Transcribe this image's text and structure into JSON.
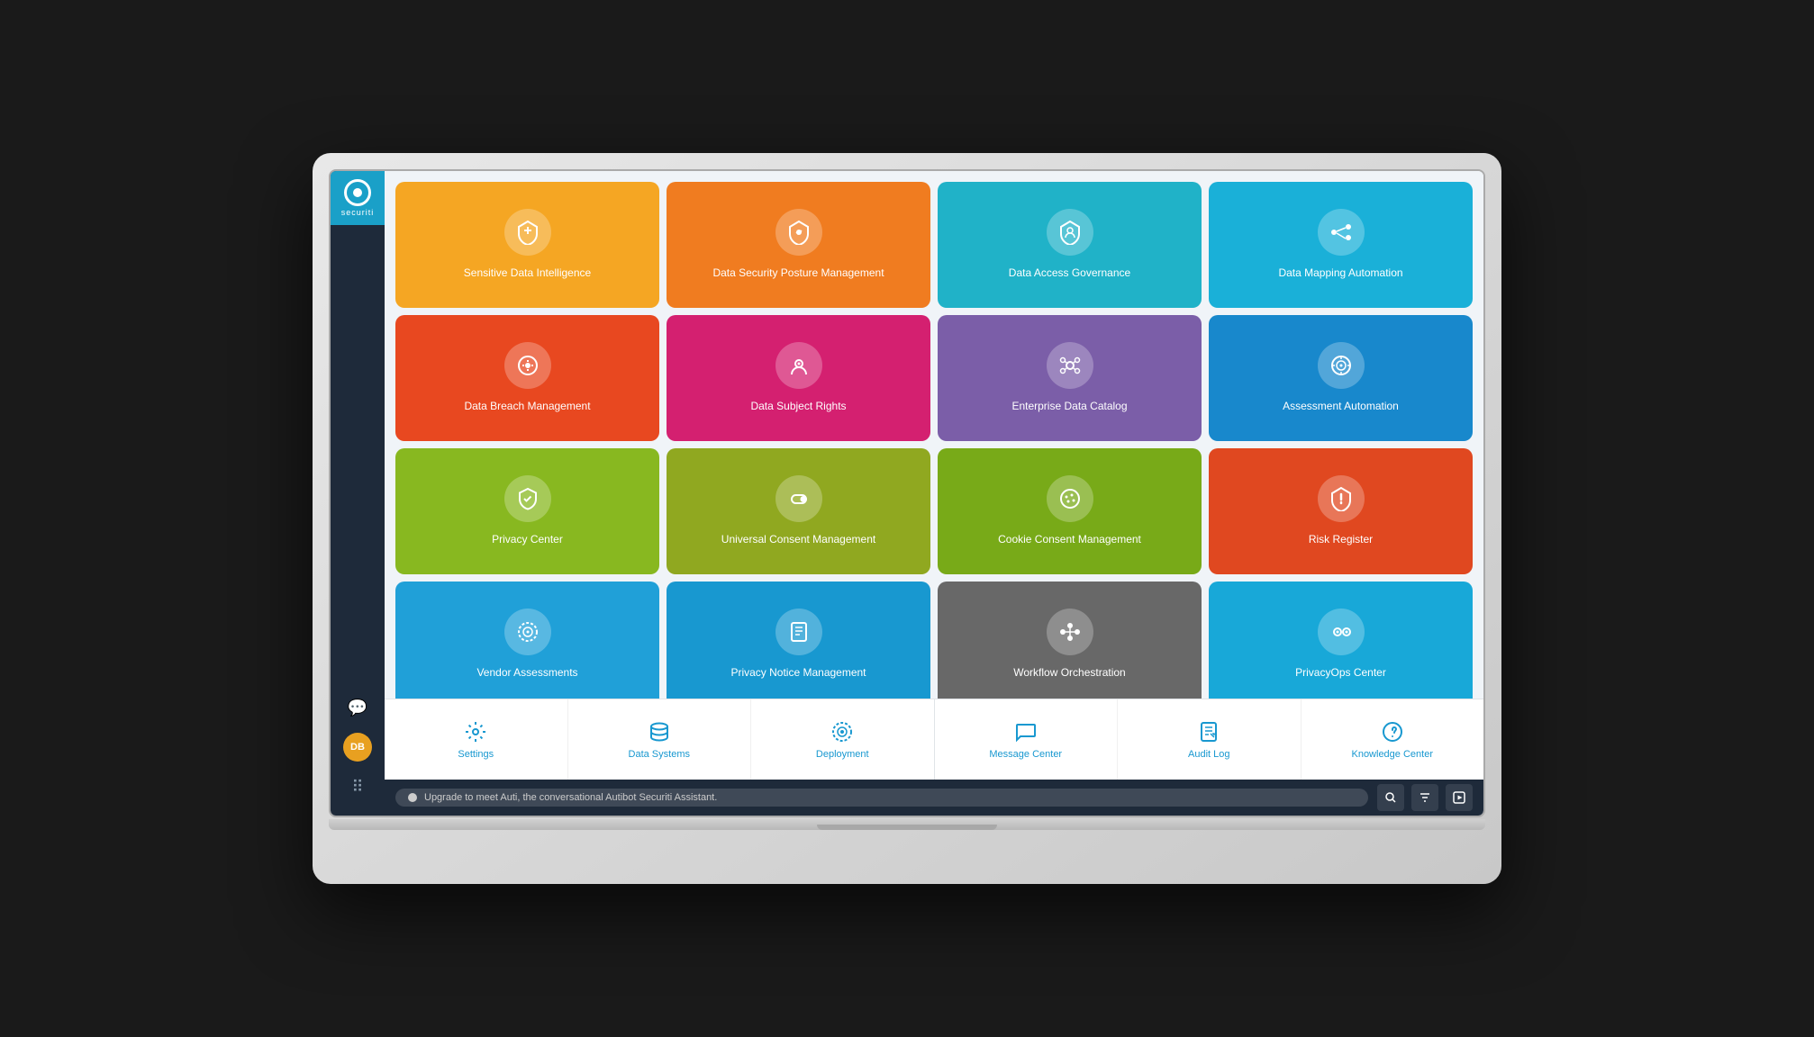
{
  "sidebar": {
    "logo_text": "securiti",
    "bottom_icons": [
      {
        "name": "chat-icon",
        "symbol": "💬"
      },
      {
        "name": "avatar-icon",
        "initials": "DB"
      },
      {
        "name": "apps-icon",
        "symbol": "⠿"
      }
    ]
  },
  "grid": {
    "rows": [
      [
        {
          "id": "sensitive-data",
          "label": "Sensitive Data Intelligence",
          "color": "tile-orange",
          "icon": "⬡"
        },
        {
          "id": "data-security-posture",
          "label": "Data Security Posture Management",
          "color": "tile-orange2",
          "icon": "🛡"
        },
        {
          "id": "data-access",
          "label": "Data Access Governance",
          "color": "tile-teal",
          "icon": "🔒"
        },
        {
          "id": "data-mapping",
          "label": "Data Mapping Automation",
          "color": "tile-cyan",
          "icon": "⇄"
        }
      ],
      [
        {
          "id": "data-breach",
          "label": "Data Breach Management",
          "color": "tile-red-orange",
          "icon": "📡"
        },
        {
          "id": "data-subject",
          "label": "Data Subject Rights",
          "color": "tile-magenta",
          "icon": "⊙"
        },
        {
          "id": "enterprise-catalog",
          "label": "Enterprise Data Catalog",
          "color": "tile-purple",
          "icon": "⦾"
        },
        {
          "id": "assessment",
          "label": "Assessment Automation",
          "color": "tile-blue",
          "icon": "◎"
        }
      ],
      [
        {
          "id": "privacy-center",
          "label": "Privacy Center",
          "color": "tile-lime",
          "icon": "⬡"
        },
        {
          "id": "universal-consent",
          "label": "Universal Consent Management",
          "color": "tile-olive",
          "icon": "⊟"
        },
        {
          "id": "cookie-consent",
          "label": "Cookie Consent Management",
          "color": "tile-green",
          "icon": "⊕"
        },
        {
          "id": "risk-register",
          "label": "Risk Register",
          "color": "tile-red",
          "icon": "⚠"
        }
      ],
      [
        {
          "id": "vendor-assessments",
          "label": "Vendor Assessments",
          "color": "tile-sky",
          "icon": "⚙"
        },
        {
          "id": "privacy-notice",
          "label": "Privacy Notice Management",
          "color": "tile-sky2",
          "icon": "≡"
        },
        {
          "id": "workflow",
          "label": "Workflow Orchestration",
          "color": "tile-gray",
          "icon": "⊕"
        },
        {
          "id": "privacyops",
          "label": "PrivacyOps Center",
          "color": "tile-cyan2",
          "icon": "⊙"
        }
      ]
    ]
  },
  "bottom_nav": {
    "left_items": [
      {
        "id": "settings",
        "label": "Settings",
        "icon": "⚙"
      },
      {
        "id": "data-systems",
        "label": "Data Systems",
        "icon": "🗄"
      },
      {
        "id": "deployment",
        "label": "Deployment",
        "icon": "⚙"
      }
    ],
    "right_items": [
      {
        "id": "message-center",
        "label": "Message Center",
        "icon": "💬"
      },
      {
        "id": "audit-log",
        "label": "Audit Log",
        "icon": "≡"
      },
      {
        "id": "knowledge-center",
        "label": "Knowledge Center",
        "icon": "?"
      }
    ]
  },
  "status_bar": {
    "message": "Upgrade to meet Auti, the conversational Autibot Securiti Assistant.",
    "actions": [
      "🔍",
      "⚙",
      "▶"
    ]
  }
}
